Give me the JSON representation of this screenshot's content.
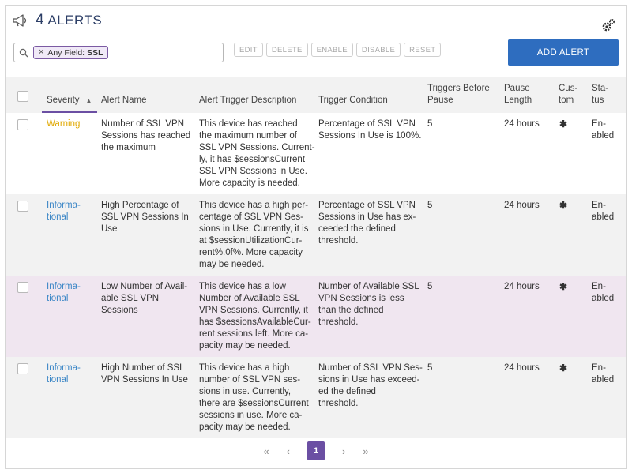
{
  "header": {
    "count": "4",
    "title": "ALERTS"
  },
  "search": {
    "chip_field": "Any Field:",
    "chip_value": "SSL"
  },
  "actions": {
    "edit": "EDIT",
    "delete": "DELETE",
    "enable": "ENABLE",
    "disable": "DISABLE",
    "reset": "RESET"
  },
  "add_alert": "ADD ALERT",
  "columns": {
    "severity": "Severity",
    "alert_name": "Alert Name",
    "description": "Alert Trigger Description",
    "condition": "Trigger Condition",
    "triggers_line1": "Triggers Before",
    "triggers_line2": "Pause",
    "pause_line1": "Pause",
    "pause_line2": "Length",
    "custom_line1": "Cus-",
    "custom_line2": "tom",
    "status_line1": "Sta-",
    "status_line2": "tus"
  },
  "sort_icon": "▲",
  "rows": [
    {
      "severity": [
        "Warning"
      ],
      "name": [
        "Number of SSL VPN",
        "Sessions has reached",
        "the maximum"
      ],
      "desc": [
        "This device has reached",
        "the maximum number of",
        "SSL VPN Sessions. Current-",
        "ly, it has $sessionsCurrent",
        "SSL VPN Sessions in Use.",
        "More capacity is needed."
      ],
      "cond": [
        "Percentage of SSL VPN",
        "Sessions In Use is 100%."
      ],
      "triggers": "5",
      "pause": "24 hours",
      "custom": "✱",
      "status": [
        "En-",
        "abled"
      ]
    },
    {
      "severity": [
        "Informa-",
        "tional"
      ],
      "name": [
        "High Percentage of",
        "SSL VPN Sessions In",
        "Use"
      ],
      "desc": [
        "This device has a high per-",
        "centage of SSL VPN Ses-",
        "sions in Use. Currently, it is",
        "at $sessionUtilizationCur-",
        "rent%.0f%. More capacity",
        "may be needed."
      ],
      "cond": [
        "Percentage of SSL VPN",
        "Sessions in Use has ex-",
        "ceeded the defined",
        "threshold."
      ],
      "triggers": "5",
      "pause": "24 hours",
      "custom": "✱",
      "status": [
        "En-",
        "abled"
      ]
    },
    {
      "severity": [
        "Informa-",
        "tional"
      ],
      "name": [
        "Low Number of Avail-",
        "able SSL VPN",
        "Sessions"
      ],
      "desc": [
        "This device has a low",
        "Number of Available SSL",
        "VPN Sessions. Currently, it",
        "has $sessionsAvailableCur-",
        "rent sessions left. More ca-",
        "pacity may be needed."
      ],
      "cond": [
        "Number of Available SSL",
        "VPN Sessions is less",
        "than the defined",
        "threshold."
      ],
      "triggers": "5",
      "pause": "24 hours",
      "custom": "✱",
      "status": [
        "En-",
        "abled"
      ]
    },
    {
      "severity": [
        "Informa-",
        "tional"
      ],
      "name": [
        "High Number of SSL",
        "VPN Sessions In Use"
      ],
      "desc": [
        "This device has a high",
        "number of SSL VPN ses-",
        "sions in use. Currently,",
        "there are $sessionsCurrent",
        "sessions in use. More ca-",
        "pacity may be needed."
      ],
      "cond": [
        "Number of SSL VPN Ses-",
        "sions in Use has exceed-",
        "ed the defined",
        "threshold."
      ],
      "triggers": "5",
      "pause": "24 hours",
      "custom": "✱",
      "status": [
        "En-",
        "abled"
      ]
    }
  ],
  "pager": {
    "first": "«",
    "prev": "‹",
    "current": "1",
    "next": "›",
    "last": "»"
  },
  "colors": {
    "accent": "#6b4fa3",
    "primary": "#2e6dbf",
    "warning": "#e0a800",
    "info": "#3b86c6",
    "selected_row": "#f0e6f0"
  }
}
